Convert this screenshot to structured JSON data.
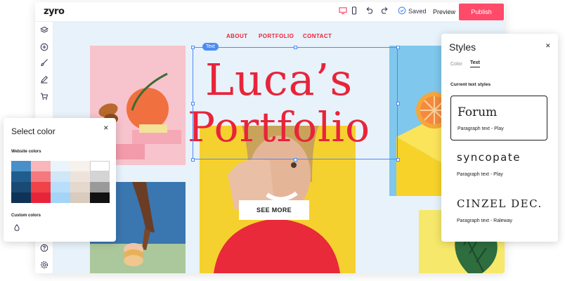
{
  "topbar": {
    "logo": "zyro",
    "saved_label": "Saved",
    "preview_label": "Preview",
    "publish_label": "Publish",
    "icons": [
      "desktop-icon",
      "mobile-icon",
      "undo-icon",
      "redo-icon",
      "check-circle-icon"
    ]
  },
  "leftbar": {
    "icons": [
      "layers-icon",
      "add-icon",
      "brush-icon",
      "pen-icon",
      "cart-icon",
      "help-icon",
      "settings-icon"
    ]
  },
  "site": {
    "nav": [
      "ABOUT",
      "PORTFOLIO",
      "CONTACT"
    ],
    "title_line1": "Luca’s",
    "title_line2": "Portfolio",
    "selection_tag": "Text",
    "see_more": "SEE MORE"
  },
  "color_panel": {
    "title": "Select color",
    "website_colors_label": "Website colors",
    "custom_colors_label": "Custom colors",
    "swatch_rows": [
      [
        "#4a90c8",
        "#f9b6bb",
        "#eaf4fb",
        "#f7f1ec",
        "#ffffff"
      ],
      [
        "#1f5d8e",
        "#f5787f",
        "#cfe7f6",
        "#eee3da",
        "#d4d4d4"
      ],
      [
        "#194a73",
        "#f04248",
        "#b9defb",
        "#e5d8cc",
        "#9a9a9a"
      ],
      [
        "#0e3356",
        "#e8243a",
        "#a4d4f7",
        "#d9cbbd",
        "#111111"
      ]
    ]
  },
  "styles_panel": {
    "title": "Styles",
    "tab_color": "Color",
    "tab_text": "Text",
    "current_styles_label": "Current text styles",
    "cards": [
      {
        "font_name": "Forum",
        "sub": "Paragraph text - Play"
      },
      {
        "font_name": "syncopate",
        "sub": "Paragraph text - Play"
      },
      {
        "font_name": "CINZEL DEC.",
        "sub": "Paragraph text - Raleway"
      }
    ]
  },
  "colors": {
    "accent": "#e8243a",
    "publish": "#ff4a6a",
    "selection": "#4a8cf5"
  }
}
